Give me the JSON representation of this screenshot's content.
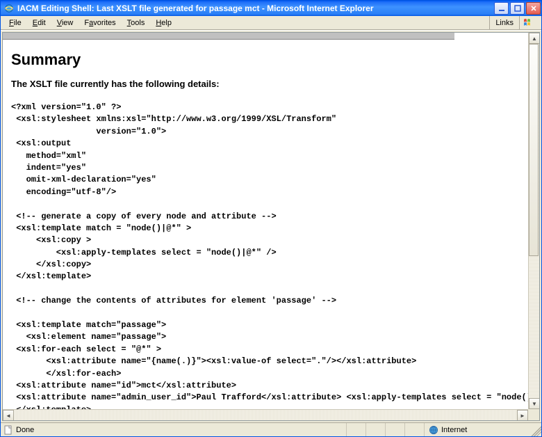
{
  "window": {
    "title": "IACM Editing Shell: Last XSLT file generated for passage mct - Microsoft Internet Explorer"
  },
  "menubar": {
    "items": [
      {
        "hot": "F",
        "rest": "ile"
      },
      {
        "hot": "E",
        "rest": "dit"
      },
      {
        "hot": "V",
        "rest": "iew"
      },
      {
        "hot": "F",
        "rest": "avorites",
        "pre": "",
        "hot2": "a"
      },
      {
        "hot": "T",
        "rest": "ools"
      },
      {
        "hot": "H",
        "rest": "elp"
      }
    ],
    "favorites_label": "Favorites",
    "links_label": "Links"
  },
  "menu": {
    "file": "File",
    "edit": "Edit",
    "view": "View",
    "favorites": "Favorites",
    "tools": "Tools",
    "help": "Help"
  },
  "page": {
    "heading": "Summary",
    "lead": "The XSLT file currently has the following details:",
    "code": "<?xml version=\"1.0\" ?>\n <xsl:stylesheet xmlns:xsl=\"http://www.w3.org/1999/XSL/Transform\"\n                 version=\"1.0\">\n <xsl:output\n   method=\"xml\"\n   indent=\"yes\"\n   omit-xml-declaration=\"yes\"\n   encoding=\"utf-8\"/>\n\n <!-- generate a copy of every node and attribute -->\n <xsl:template match = \"node()|@*\" >\n     <xsl:copy >\n         <xsl:apply-templates select = \"node()|@*\" />\n     </xsl:copy>\n </xsl:template>\n\n <!-- change the contents of attributes for element 'passage' -->\n\n <xsl:template match=\"passage\">\n   <xsl:element name=\"passage\">\n <xsl:for-each select = \"@*\" >\n       <xsl:attribute name=\"{name(.)}\"><xsl:value-of select=\".\"/></xsl:attribute>\n       </xsl:for-each>\n <xsl:attribute name=\"id\">mct</xsl:attribute>\n <xsl:attribute name=\"admin_user_id\">Paul Trafford</xsl:attribute> <xsl:apply-templates select = \"node()\"\n </xsl:template>"
  },
  "status": {
    "done": "Done",
    "zone": "Internet"
  }
}
